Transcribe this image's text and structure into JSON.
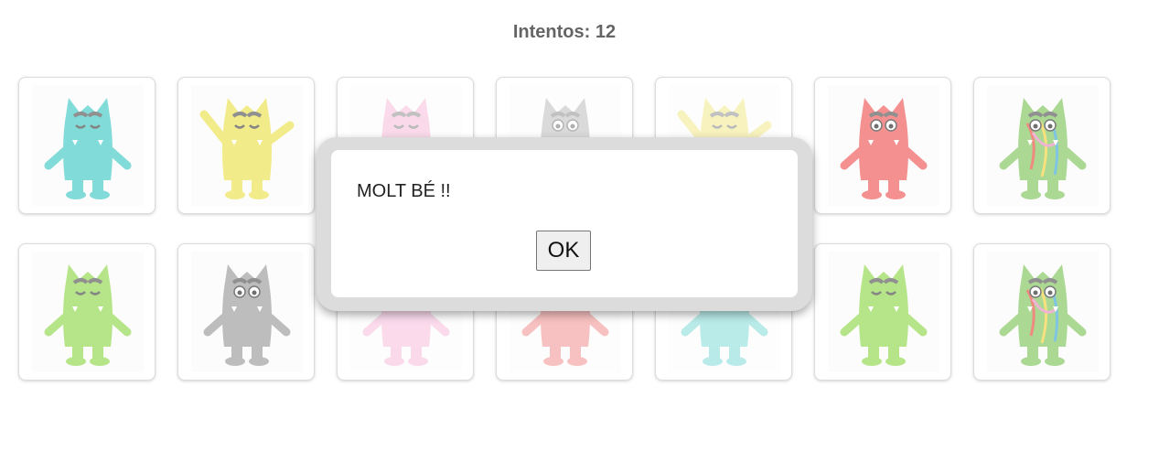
{
  "header": {
    "attempts_label": "Intentos: 12"
  },
  "board": {
    "cards": [
      {
        "monster": "teal-calm-monster-icon",
        "color": "#3ec8c4"
      },
      {
        "monster": "yellow-happy-monster-icon",
        "color": "#ece04c"
      },
      {
        "monster": "pink-love-monster-icon",
        "color": "#f39ac8"
      },
      {
        "monster": "gray-scared-monster-icon",
        "color": "#9a9a9a"
      },
      {
        "monster": "yellow-happy-monster-icon",
        "color": "#ece04c"
      },
      {
        "monster": "red-angry-monster-icon",
        "color": "#ee5555"
      },
      {
        "monster": "multicolor-confused-monster-icon",
        "color": "#7fc35a"
      },
      {
        "monster": "green-calm-monster-icon",
        "color": "#8fd84a"
      },
      {
        "monster": "gray-scared-monster-icon",
        "color": "#9a9a9a"
      },
      {
        "monster": "pink-love-monster-icon",
        "color": "#f39ac8"
      },
      {
        "monster": "red-angry-monster-icon",
        "color": "#ee5555"
      },
      {
        "monster": "teal-calm-monster-icon",
        "color": "#3ec8c4"
      },
      {
        "monster": "green-calm-monster-icon",
        "color": "#8fd84a"
      },
      {
        "monster": "multicolor-confused-monster-icon",
        "color": "#7fc35a"
      }
    ]
  },
  "dialog": {
    "message": "MOLT BÉ !!",
    "ok_label": "OK"
  }
}
